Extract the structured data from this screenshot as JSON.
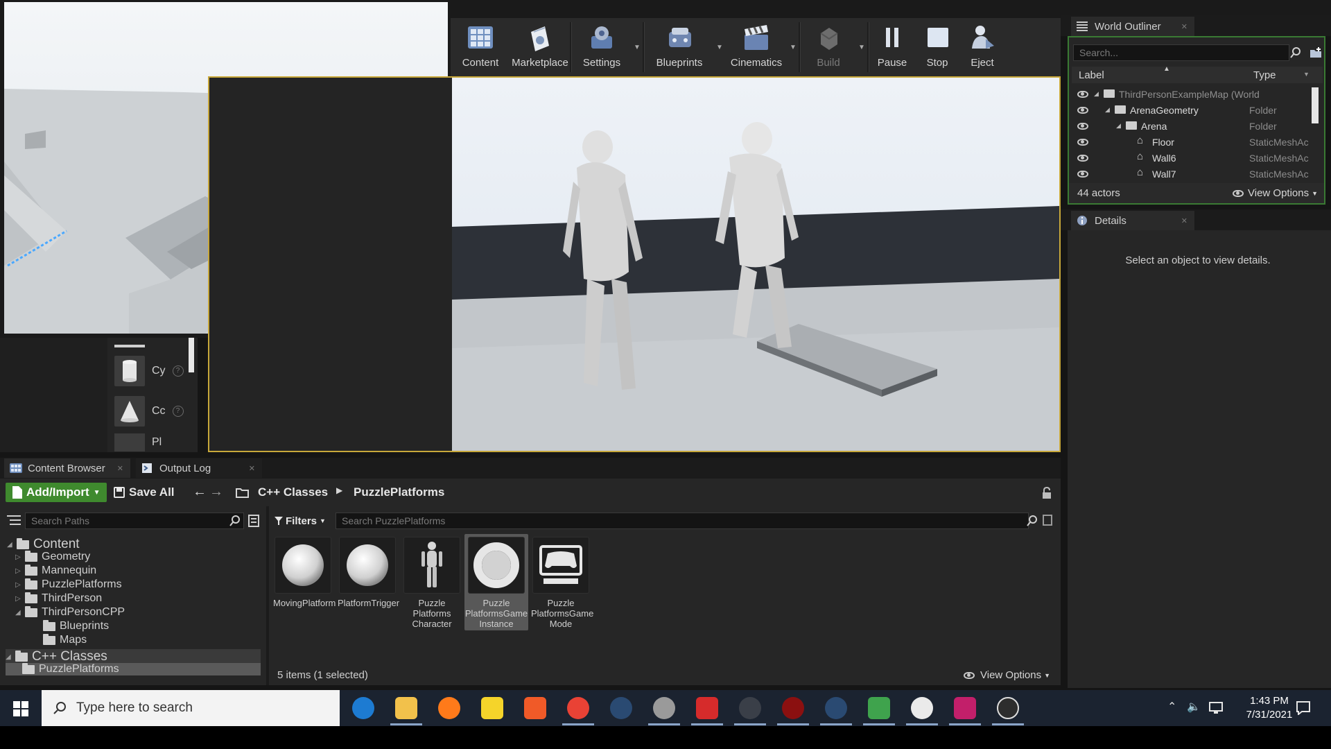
{
  "toolbar": {
    "buttons": [
      {
        "label": "Content",
        "icon": "content-icon"
      },
      {
        "label": "Marketplace",
        "icon": "marketplace-icon"
      },
      {
        "label": "Settings",
        "icon": "settings-icon"
      },
      {
        "label": "Blueprints",
        "icon": "blueprints-icon"
      },
      {
        "label": "Cinematics",
        "icon": "cinematics-icon"
      },
      {
        "label": "Build",
        "icon": "build-icon"
      },
      {
        "label": "Pause",
        "icon": "pause-icon"
      },
      {
        "label": "Stop",
        "icon": "stop-icon"
      },
      {
        "label": "Eject",
        "icon": "eject-icon"
      }
    ]
  },
  "place_actors": {
    "items": [
      {
        "label": "Cy",
        "icon": "cylinder-icon"
      },
      {
        "label": "Cc",
        "icon": "cone-icon"
      },
      {
        "label": "Pl",
        "icon": "plane-icon"
      }
    ]
  },
  "world_outliner": {
    "tab_label": "World Outliner",
    "search_placeholder": "Search...",
    "col_label": "Label",
    "col_type": "Type",
    "rows": [
      {
        "label": "ThirdPersonExampleMap (World",
        "type": "",
        "indent": 0
      },
      {
        "label": "ArenaGeometry",
        "type": "Folder",
        "indent": 1
      },
      {
        "label": "Arena",
        "type": "Folder",
        "indent": 2
      },
      {
        "label": "Floor",
        "type": "StaticMeshAc",
        "indent": 3
      },
      {
        "label": "Wall6",
        "type": "StaticMeshAc",
        "indent": 3
      },
      {
        "label": "Wall7",
        "type": "StaticMeshAc",
        "indent": 3
      }
    ],
    "actor_count": "44 actors",
    "view_options": "View Options"
  },
  "details": {
    "tab_label": "Details",
    "empty_message": "Select an object to view details."
  },
  "content_browser": {
    "tab_label": "Content Browser",
    "output_log_label": "Output Log",
    "add_import": "Add/Import",
    "save_all": "Save All",
    "breadcrumb": [
      "C++ Classes",
      "PuzzlePlatforms"
    ],
    "search_paths_placeholder": "Search Paths",
    "filters_label": "Filters",
    "search_assets_placeholder": "Search PuzzlePlatforms",
    "tree": [
      {
        "label": "Content",
        "level": 0
      },
      {
        "label": "Geometry",
        "level": 1
      },
      {
        "label": "Mannequin",
        "level": 1
      },
      {
        "label": "PuzzlePlatforms",
        "level": 1
      },
      {
        "label": "ThirdPerson",
        "level": 1
      },
      {
        "label": "ThirdPersonCPP",
        "level": 1
      },
      {
        "label": "Blueprints",
        "level": 2
      },
      {
        "label": "Maps",
        "level": 2
      },
      {
        "label": "C++ Classes",
        "level": 0
      },
      {
        "label": "PuzzlePlatforms",
        "level": 1
      }
    ],
    "assets": [
      {
        "label": "MovingPlatform",
        "icon": "sphere-icon"
      },
      {
        "label": "PlatformTrigger",
        "icon": "sphere-icon"
      },
      {
        "label": "Puzzle Platforms Character",
        "icon": "mannequin-icon"
      },
      {
        "label": "Puzzle PlatformsGame Instance",
        "icon": "ring-icon",
        "selected": true
      },
      {
        "label": "Puzzle PlatformsGame Mode",
        "icon": "gamepad-icon"
      }
    ],
    "status": "5 items (1 selected)",
    "view_options": "View Options"
  },
  "taskbar": {
    "search_placeholder": "Type here to search",
    "time": "1:43 PM",
    "date": "7/31/2021"
  },
  "colors": {
    "accent_green": "#3f8a2e",
    "viewport_border": "#c8a83a",
    "outliner_highlight": "#3a7a33"
  }
}
